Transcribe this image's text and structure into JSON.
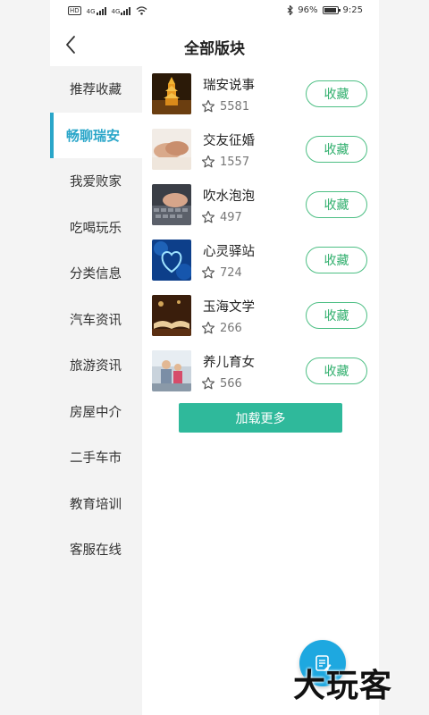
{
  "status_bar": {
    "hd_label": "HD",
    "net1": "4G",
    "net2": "4G",
    "battery_percent": "96%",
    "time": "9:25"
  },
  "header": {
    "title": "全部版块",
    "back_icon": "chevron-left-icon"
  },
  "sidebar": {
    "active_index": 1,
    "accent_color": "#2aa6c9",
    "items": [
      {
        "label": "推荐收藏"
      },
      {
        "label": "畅聊瑞安"
      },
      {
        "label": "我爱败家"
      },
      {
        "label": "吃喝玩乐"
      },
      {
        "label": "分类信息"
      },
      {
        "label": "汽车资讯"
      },
      {
        "label": "旅游资讯"
      },
      {
        "label": "房屋中介"
      },
      {
        "label": "二手车市"
      },
      {
        "label": "教育培训"
      },
      {
        "label": "客服在线"
      }
    ]
  },
  "forums": [
    {
      "title": "瑞安说事",
      "count": "5581",
      "button": "收藏",
      "thumb_icon": "pagoda-night-image"
    },
    {
      "title": "交友征婚",
      "count": "1557",
      "button": "收藏",
      "thumb_icon": "holding-hands-image"
    },
    {
      "title": "吹水泡泡",
      "count": "497",
      "button": "收藏",
      "thumb_icon": "keyboard-typing-image"
    },
    {
      "title": "心灵驿站",
      "count": "724",
      "button": "收藏",
      "thumb_icon": "blue-heart-image"
    },
    {
      "title": "玉海文学",
      "count": "266",
      "button": "收藏",
      "thumb_icon": "open-book-image"
    },
    {
      "title": "养儿育女",
      "count": "566",
      "button": "收藏",
      "thumb_icon": "family-photo-image"
    }
  ],
  "load_more": "加载更多",
  "fab_icon": "edit-note-icon",
  "watermark": "大玩客",
  "colors": {
    "button_border": "#4dbf84",
    "load_more_bg": "#2fb99b",
    "fab_bg": "#1ea8e0"
  }
}
